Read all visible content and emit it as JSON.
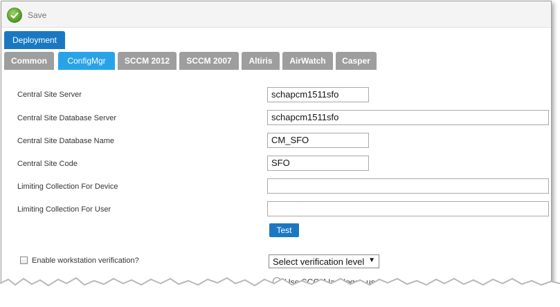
{
  "toolbar": {
    "save_label": "Save"
  },
  "tabs": {
    "main": "Deployment",
    "sub": [
      "Common",
      "ConfigMgr",
      "SCCM 2012",
      "SCCM 2007",
      "Altiris",
      "AirWatch",
      "Casper"
    ],
    "active_sub": "ConfigMgr"
  },
  "form": {
    "fields": [
      {
        "label": "Central Site Server",
        "value": "schapcm1511sfo"
      },
      {
        "label": "Central Site Database Server",
        "value": "schapcm1511sfo"
      },
      {
        "label": "Central Site Database Name",
        "value": "CM_SFO"
      },
      {
        "label": "Central Site Code",
        "value": "SFO"
      },
      {
        "label": "Limiting Collection For Device",
        "value": ""
      },
      {
        "label": "Limiting Collection For User",
        "value": ""
      }
    ],
    "test_label": "Test",
    "enable_verification_label": "Enable workstation verification?",
    "verification_level_selected": "Select verification level",
    "radio_option_label": "Use SCCM last logon user"
  },
  "colors": {
    "accent_blue": "#1a78c2",
    "active_tab": "#29a3e8",
    "inactive_tab": "#9e9e9e"
  }
}
